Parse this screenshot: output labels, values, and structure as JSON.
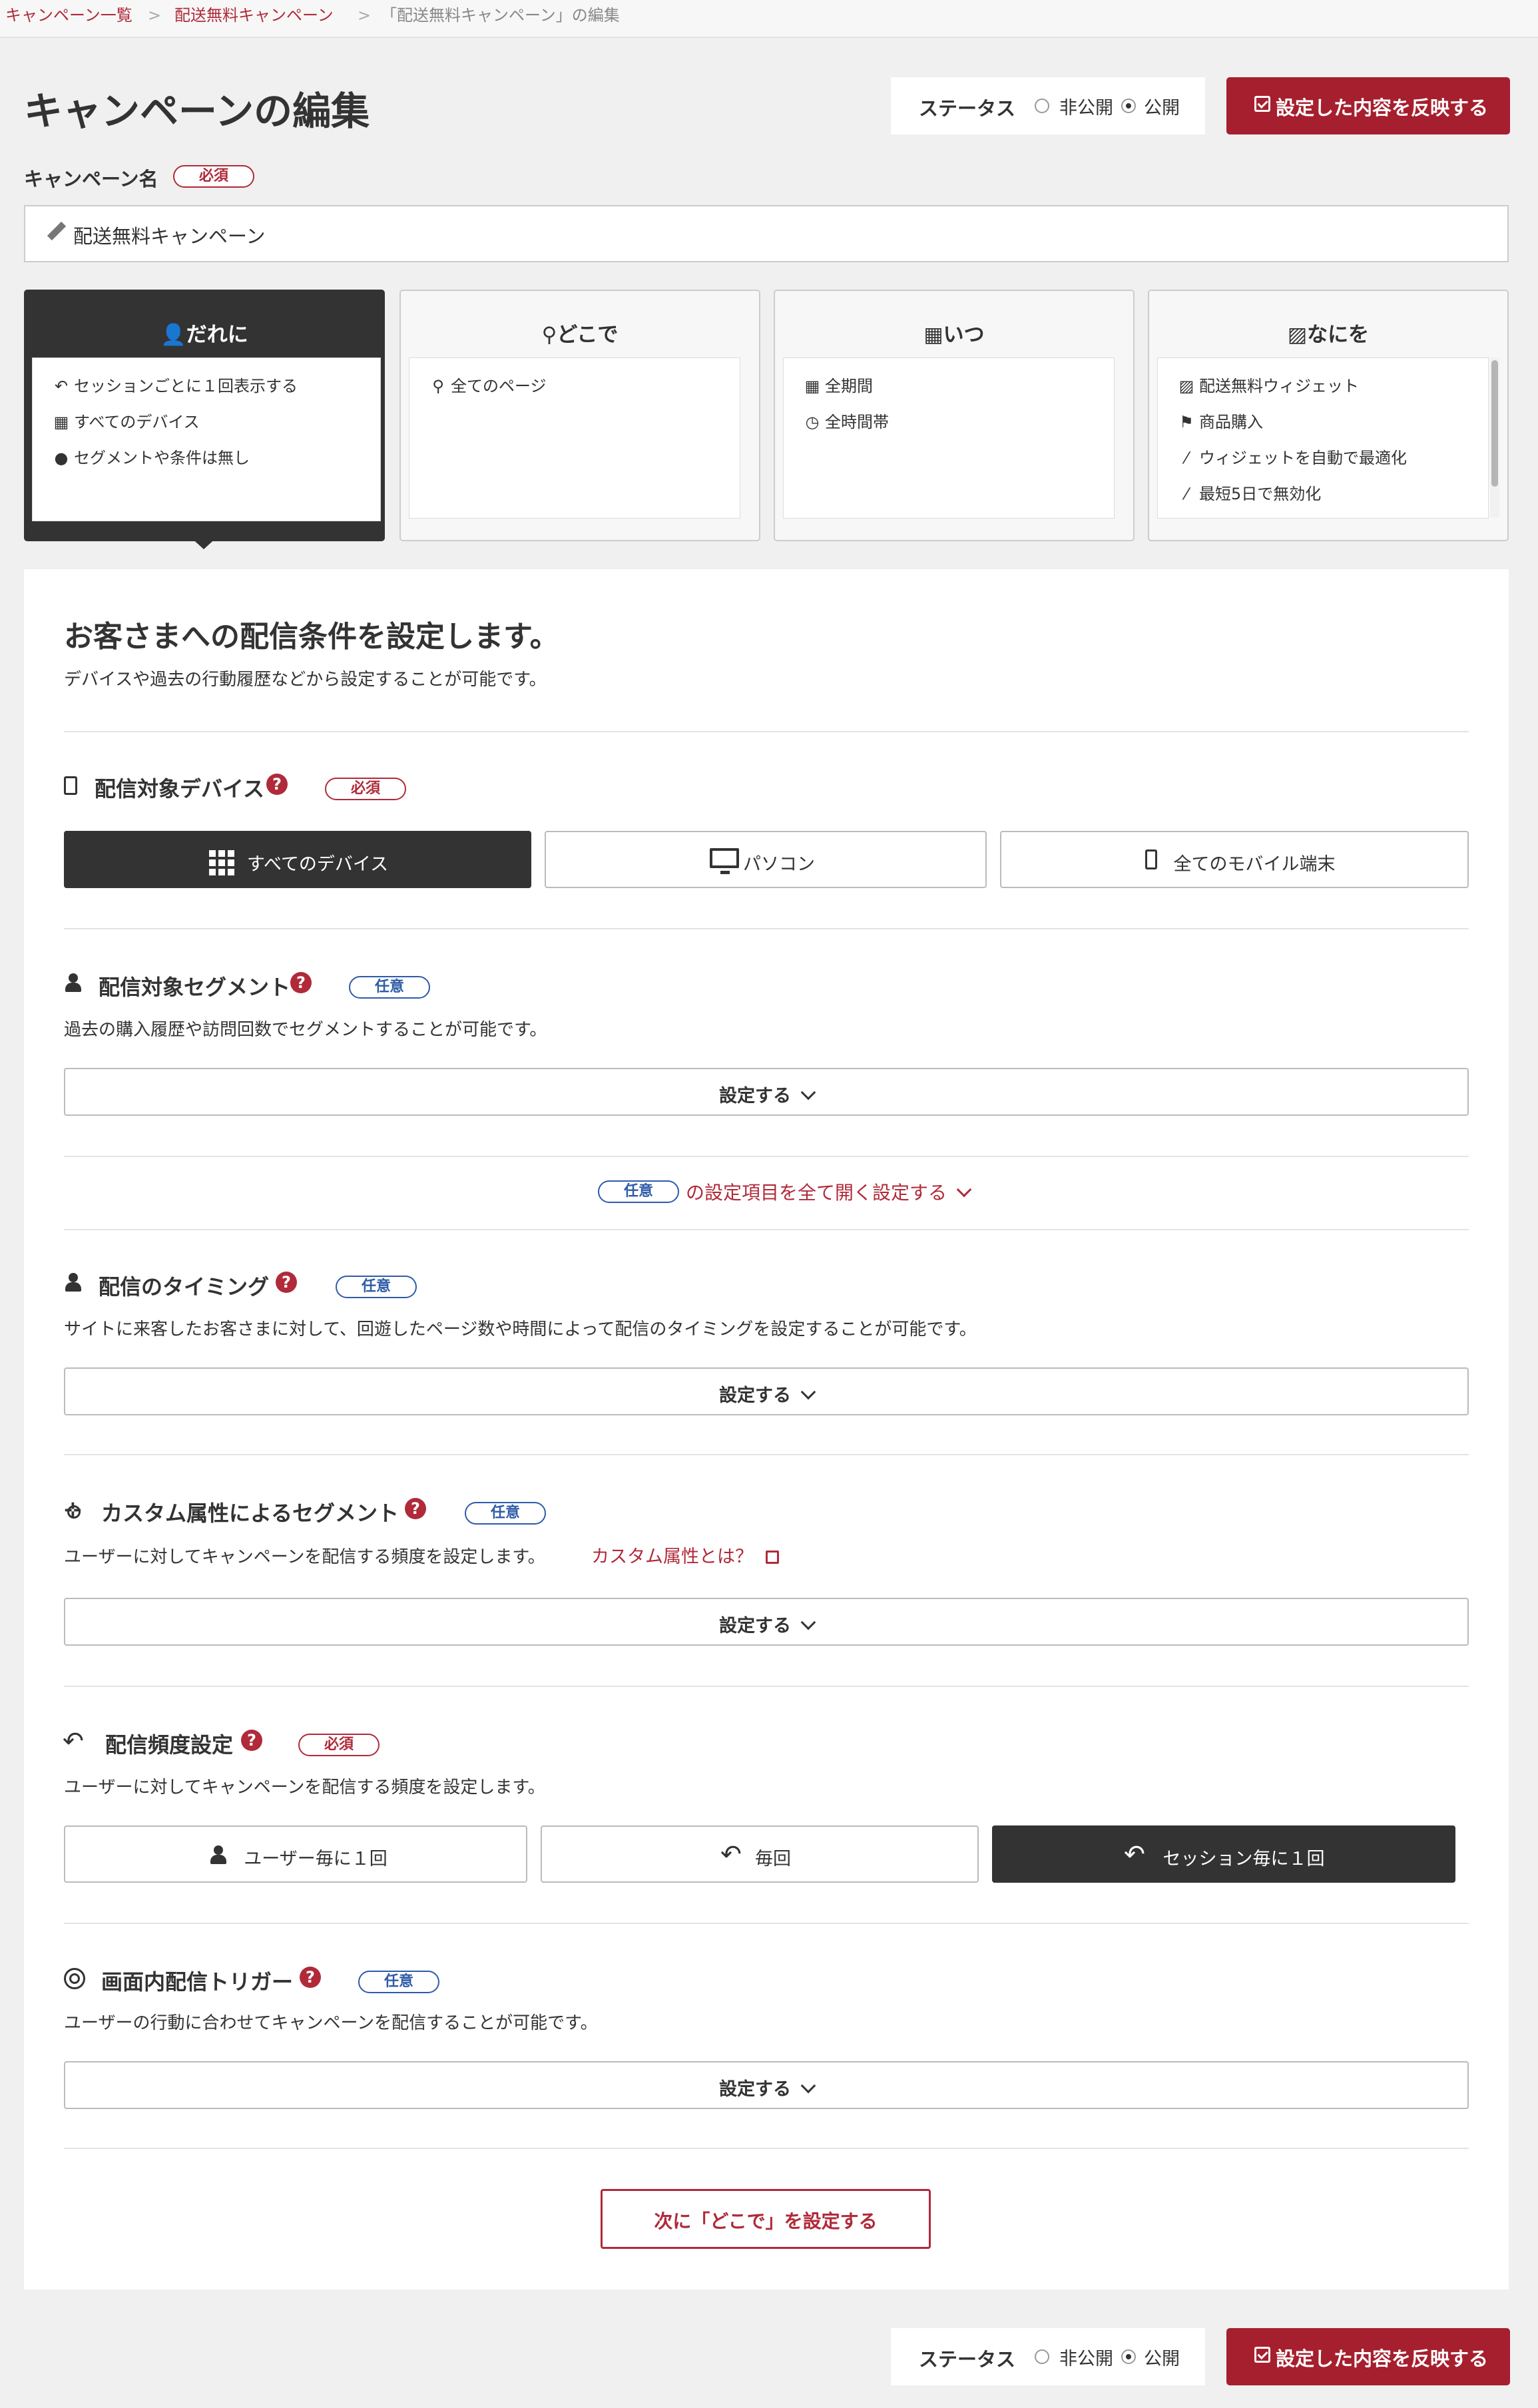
{
  "breadcrumb": {
    "items": [
      "キャンペーン一覧",
      "配送無料キャンペーン",
      "「配送無料キャンペーン」の編集"
    ],
    "separator": ">"
  },
  "header": {
    "title": "キャンペーンの編集",
    "status_label": "ステータス",
    "status_options": [
      "非公開",
      "公開"
    ],
    "status_selected": "公開",
    "apply_label": "設定した内容を反映する"
  },
  "campaign_name": {
    "label": "キャンペーン名",
    "required_badge": "必須",
    "value": "配送無料キャンペーン"
  },
  "tabs": [
    {
      "title": "だれに",
      "icon": "user-icon",
      "active": true,
      "items": [
        {
          "icon": "reply-icon",
          "text": "セッションごとに１回表示する"
        },
        {
          "icon": "grid-icon",
          "text": "すべてのデバイス"
        },
        {
          "icon": "user-icon",
          "text": "セグメントや条件は無し"
        }
      ]
    },
    {
      "title": "どこで",
      "icon": "map-marker-icon",
      "active": false,
      "items": [
        {
          "icon": "map-marker-icon",
          "text": "全てのページ"
        }
      ]
    },
    {
      "title": "いつ",
      "icon": "calendar-icon",
      "active": false,
      "items": [
        {
          "icon": "calendar-icon",
          "text": "全期間"
        },
        {
          "icon": "clock-icon",
          "text": "全時間帯"
        }
      ]
    },
    {
      "title": "なにを",
      "icon": "image-icon",
      "active": false,
      "items": [
        {
          "icon": "image-icon",
          "text": "配送無料ウィジェット"
        },
        {
          "icon": "flag-icon",
          "text": "商品購入"
        },
        {
          "icon": "magic-wand-icon",
          "text": "ウィジェットを自動で最適化"
        },
        {
          "icon": "magic-wand-icon",
          "text": "最短5日で無効化"
        }
      ]
    }
  ],
  "main": {
    "title": "お客さまへの配信条件を設定します。",
    "subtitle": "デバイスや過去の行動履歴などから設定することが可能です。",
    "device": {
      "title": "配信対象デバイス",
      "badge": "必須",
      "options": [
        "すべてのデバイス",
        "パソコン",
        "全てのモバイル端末"
      ],
      "selected": "すべてのデバイス"
    },
    "segment": {
      "title": "配信対象セグメント",
      "badge": "任意",
      "desc": "過去の購入履歴や訪問回数でセグメントすることが可能です。",
      "button": "設定する"
    },
    "expand": {
      "badge": "任意",
      "text": "の設定項目を全て開く設定する"
    },
    "timing": {
      "title": "配信のタイミング",
      "badge": "任意",
      "desc": "サイトに来客したお客さまに対して、回遊したページ数や時間によって配信のタイミングを設定することが可能です。",
      "button": "設定する"
    },
    "custom": {
      "title": "カスタム属性によるセグメント",
      "badge": "任意",
      "desc": "ユーザーに対してキャンペーンを配信する頻度を設定します。",
      "link": "カスタム属性とは？",
      "button": "設定する"
    },
    "frequency": {
      "title": "配信頻度設定",
      "badge": "必須",
      "desc": "ユーザーに対してキャンペーンを配信する頻度を設定します。",
      "options": [
        "ユーザー毎に１回",
        "毎回",
        "セッション毎に１回"
      ],
      "selected": "セッション毎に１回"
    },
    "trigger": {
      "title": "画面内配信トリガー",
      "badge": "任意",
      "desc": "ユーザーの行動に合わせてキャンペーンを配信することが可能です。",
      "button": "設定する"
    },
    "next_button": "次に「どこで」を設定する",
    "help_glyph": "?"
  },
  "footer": {
    "status_label": "ステータス",
    "status_options": [
      "非公開",
      "公開"
    ],
    "status_selected": "公開",
    "apply_label": "設定した内容を反映する"
  },
  "colors": {
    "accent": "#a61f2e",
    "dark": "#333333",
    "optional_badge": "#2e5ba8",
    "background": "#f0f0f0"
  }
}
